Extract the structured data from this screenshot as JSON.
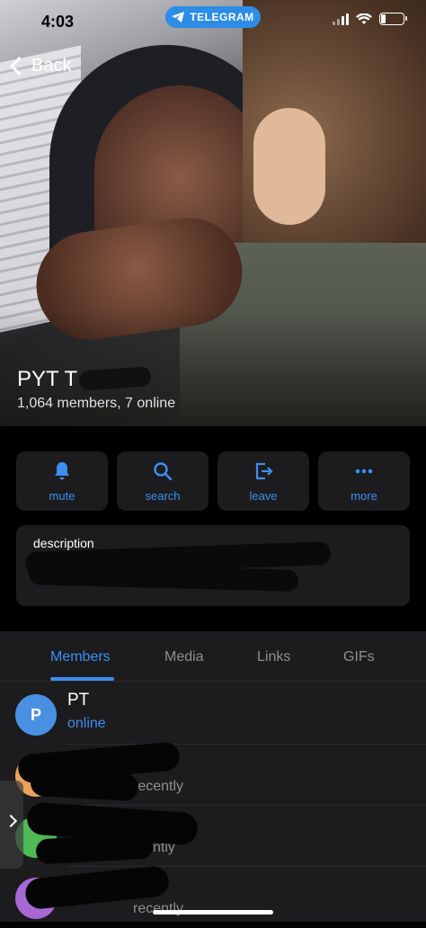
{
  "status_bar": {
    "time": "4:03",
    "pill_label": "TELEGRAM"
  },
  "nav": {
    "back_label": "Back"
  },
  "group": {
    "name": "PYT T",
    "members_line": "1,064 members, 7 online"
  },
  "actions": [
    {
      "label": "mute",
      "icon": "bell-icon"
    },
    {
      "label": "search",
      "icon": "search-icon"
    },
    {
      "label": "leave",
      "icon": "leave-icon"
    },
    {
      "label": "more",
      "icon": "more-dots-icon"
    }
  ],
  "description": {
    "label": "description"
  },
  "tabs": {
    "items": [
      "Members",
      "Media",
      "Links",
      "GIFs"
    ],
    "active": "Members"
  },
  "members": [
    {
      "initial": "P",
      "name": "PT",
      "status": "online",
      "avatar_color": "#4a90e2",
      "status_color": "#3e8ef0"
    },
    {
      "initial": "",
      "name": "",
      "status": "recently",
      "avatar_color": "#e8a25a",
      "status_color": "#8e8e93"
    },
    {
      "initial": "",
      "name": "",
      "status": "ntly",
      "avatar_color": "#4fb955",
      "status_color": "#8e8e93"
    },
    {
      "initial": "",
      "name": "",
      "status": "recently",
      "avatar_color": "#a768d6",
      "status_color": "#8e8e93"
    }
  ],
  "colors": {
    "accent": "#3e8ef0",
    "card_bg": "#1c1c1e",
    "telegram_pill": "#2d8de6"
  }
}
